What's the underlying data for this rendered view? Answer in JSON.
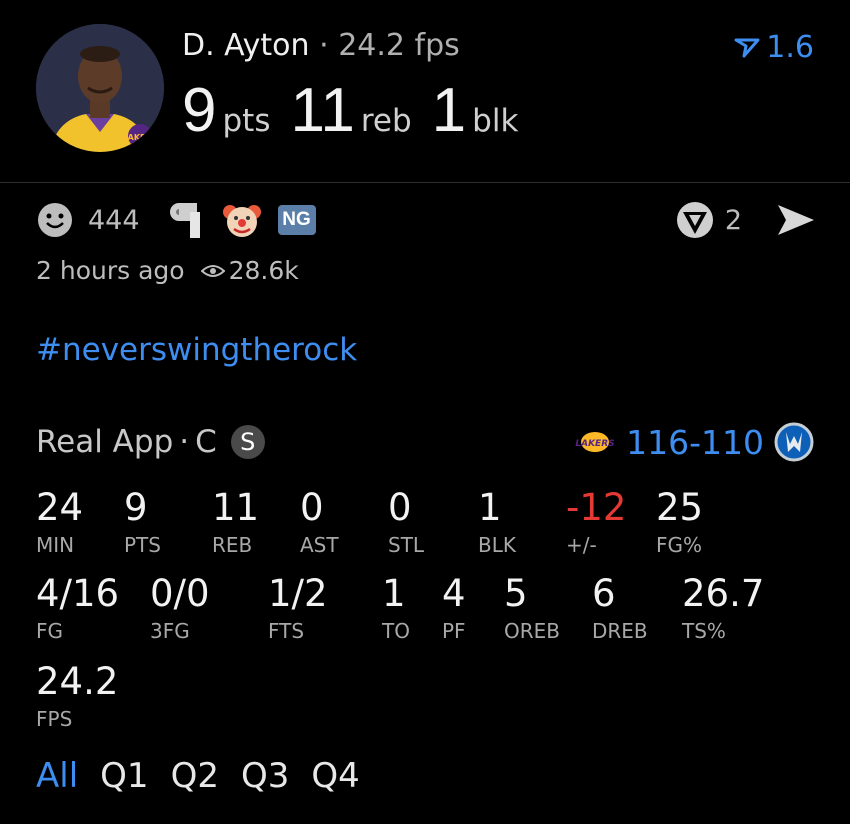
{
  "header": {
    "player_name": "D. Ayton",
    "separator": "·",
    "fps_text": "24.2 fps",
    "pts": "9",
    "pts_unit": "pts",
    "reb": "11",
    "reb_unit": "reb",
    "blk": "1",
    "blk_unit": "blk",
    "rating": "1.6",
    "avatar_team": "LAKERS"
  },
  "reactions": {
    "smile_count": "444",
    "ng_badge": "NG",
    "share_count": "2"
  },
  "meta": {
    "time": "2 hours ago",
    "views": "28.6k"
  },
  "hashtag": "#neverswingtherock",
  "game": {
    "source": "Real App",
    "position": "C",
    "badge": "S",
    "team_logo_text": "LAKERS",
    "score": "116-110"
  },
  "stats_row1": [
    {
      "value": "24",
      "label": "MIN"
    },
    {
      "value": "9",
      "label": "PTS"
    },
    {
      "value": "11",
      "label": "REB"
    },
    {
      "value": "0",
      "label": "AST"
    },
    {
      "value": "0",
      "label": "STL"
    },
    {
      "value": "1",
      "label": "BLK"
    },
    {
      "value": "-12",
      "label": "+/-"
    },
    {
      "value": "25",
      "label": "FG%"
    }
  ],
  "stats_row2": [
    {
      "value": "4/16",
      "label": "FG"
    },
    {
      "value": "0/0",
      "label": "3FG"
    },
    {
      "value": "1/2",
      "label": "FTS"
    },
    {
      "value": "1",
      "label": "TO"
    },
    {
      "value": "4",
      "label": "PF"
    },
    {
      "value": "5",
      "label": "OREB"
    },
    {
      "value": "6",
      "label": "DREB"
    },
    {
      "value": "26.7",
      "label": "TS%"
    }
  ],
  "stats_row3": [
    {
      "value": "24.2",
      "label": "FPS"
    }
  ],
  "tabs": [
    "All",
    "Q1",
    "Q2",
    "Q3",
    "Q4"
  ],
  "colors": {
    "accent": "#3d8ef0",
    "negative": "#e53935",
    "background": "#000000"
  }
}
